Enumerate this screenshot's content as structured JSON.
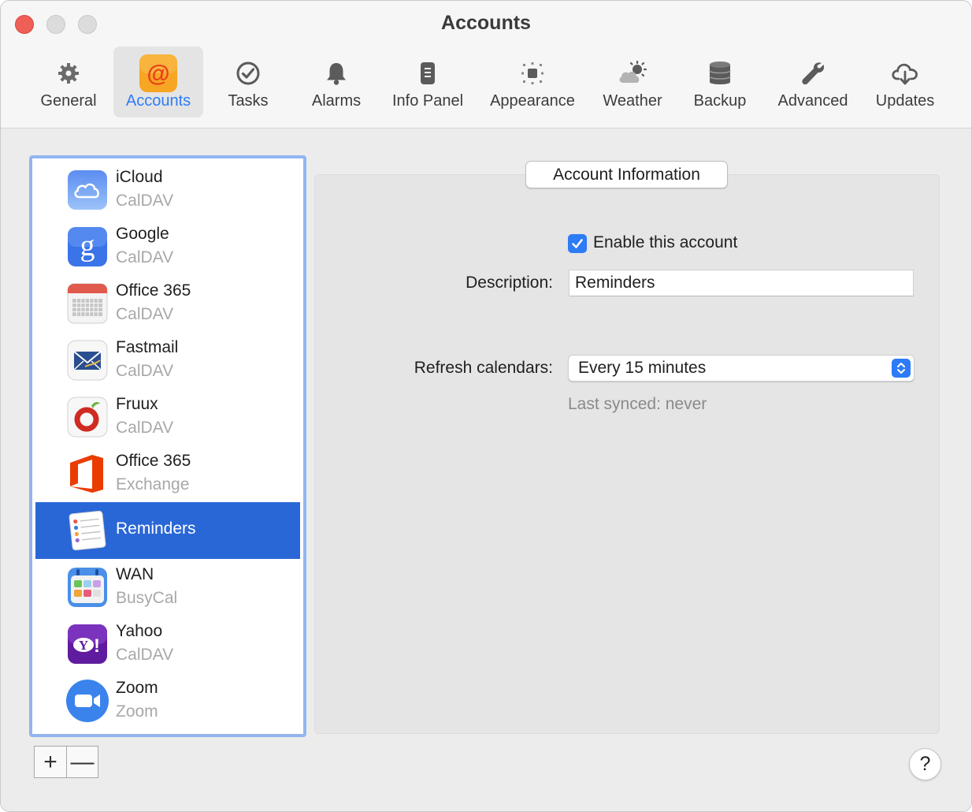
{
  "window": {
    "title": "Accounts"
  },
  "toolbar": {
    "tabs": [
      {
        "label": "General",
        "icon": "gear-icon"
      },
      {
        "label": "Accounts",
        "icon": "at-sign-icon",
        "active": true
      },
      {
        "label": "Tasks",
        "icon": "checkmark-circle-icon"
      },
      {
        "label": "Alarms",
        "icon": "bell-icon"
      },
      {
        "label": "Info Panel",
        "icon": "info-panel-icon"
      },
      {
        "label": "Appearance",
        "icon": "appearance-icon"
      },
      {
        "label": "Weather",
        "icon": "weather-icon"
      },
      {
        "label": "Backup",
        "icon": "database-icon"
      },
      {
        "label": "Advanced",
        "icon": "wrench-icon"
      },
      {
        "label": "Updates",
        "icon": "cloud-download-icon"
      }
    ]
  },
  "accounts": {
    "items": [
      {
        "name": "iCloud",
        "type": "CalDAV",
        "icon": "icloud-icon"
      },
      {
        "name": "Google",
        "type": "CalDAV",
        "icon": "google-icon"
      },
      {
        "name": "Office 365",
        "type": "CalDAV",
        "icon": "calendar-icon"
      },
      {
        "name": "Fastmail",
        "type": "CalDAV",
        "icon": "fastmail-icon"
      },
      {
        "name": "Fruux",
        "type": "CalDAV",
        "icon": "fruux-icon"
      },
      {
        "name": "Office 365",
        "type": "Exchange",
        "icon": "office-icon"
      },
      {
        "name": "Reminders",
        "type": "",
        "icon": "reminders-icon",
        "selected": true
      },
      {
        "name": "WAN",
        "type": "BusyCal",
        "icon": "busycal-icon"
      },
      {
        "name": "Yahoo",
        "type": "CalDAV",
        "icon": "yahoo-icon"
      },
      {
        "name": "Zoom",
        "type": "Zoom",
        "icon": "zoom-icon"
      }
    ],
    "add_label": "+",
    "remove_label": "—"
  },
  "panel": {
    "tab_label": "Account Information",
    "enable_label": "Enable this account",
    "enabled": true,
    "description_label": "Description:",
    "description_value": "Reminders",
    "refresh_label": "Refresh calendars:",
    "refresh_value": "Every 15 minutes",
    "last_synced": "Last synced: never"
  },
  "help_label": "?",
  "colors": {
    "accent": "#2d7bf6",
    "selection": "#2a67d6",
    "list_border": "#92b5f0"
  }
}
